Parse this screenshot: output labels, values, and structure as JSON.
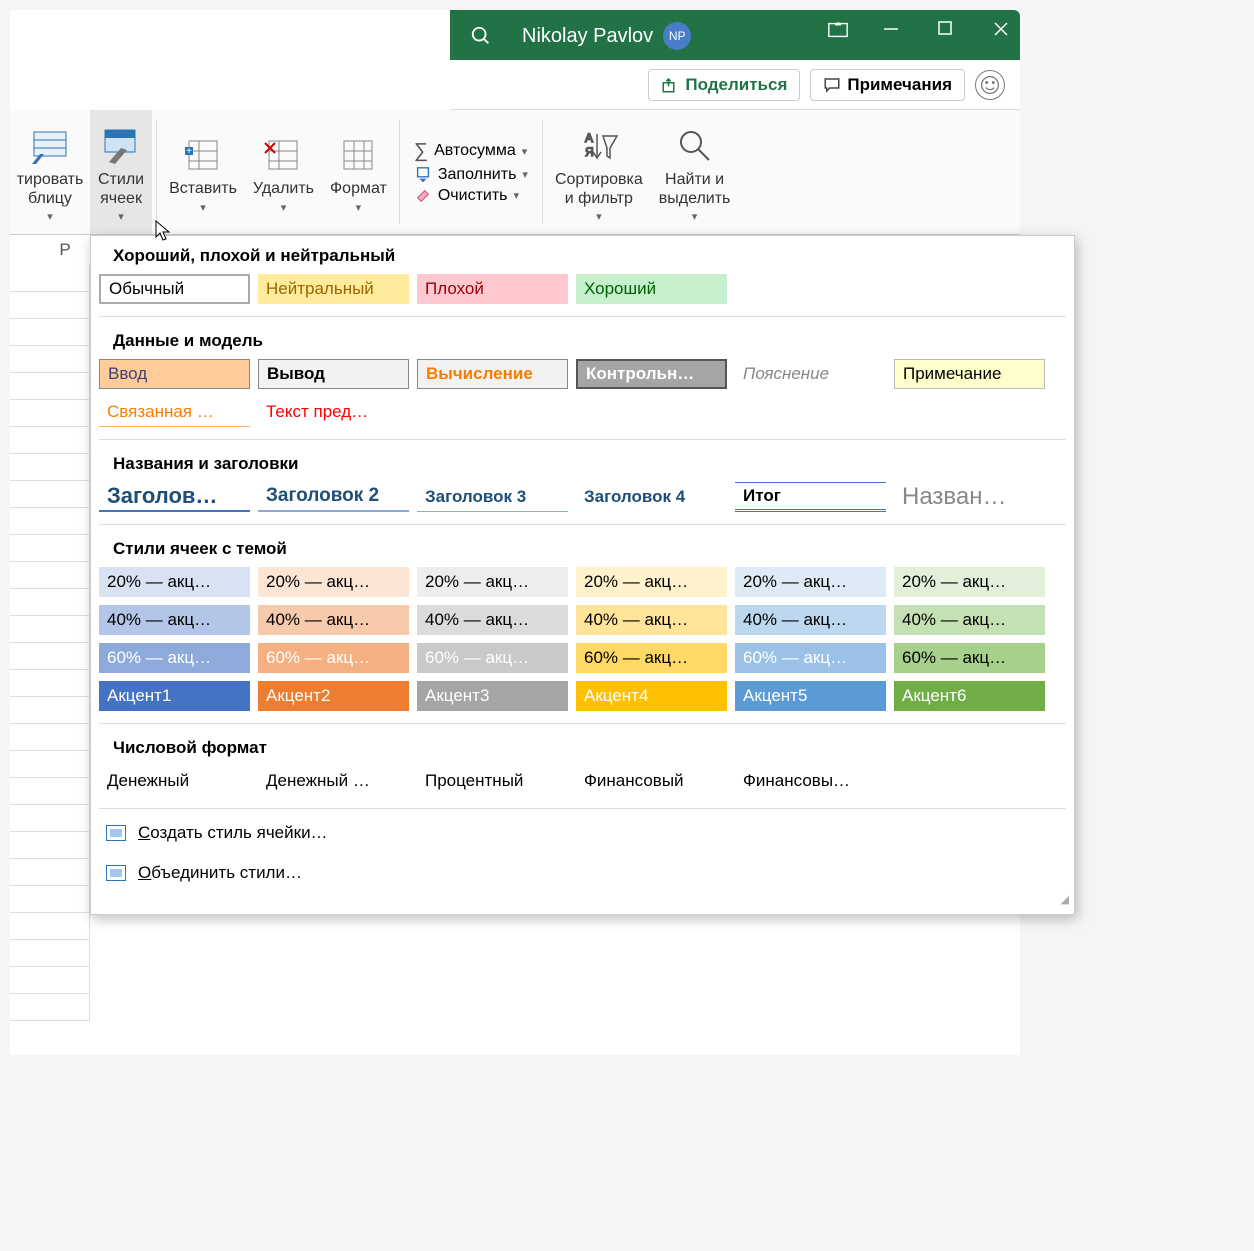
{
  "titlebar": {
    "user_name": "Nikolay Pavlov",
    "avatar_initials": "NP"
  },
  "actions": {
    "share": "Поделиться",
    "comments": "Примечания"
  },
  "ribbon": {
    "format_table": "тировать\nблицу",
    "cell_styles": "Стили\nячеек",
    "insert": "Вставить",
    "delete": "Удалить",
    "format": "Формат",
    "autosum": "Автосумма",
    "fill": "Заполнить",
    "clear": "Очистить",
    "sort_filter": "Сортировка\nи фильтр",
    "find_select": "Найти и\nвыделить"
  },
  "column_header": "P",
  "dropdown": {
    "sec1_title": "Хороший, плохой и нейтральный",
    "sec1": [
      "Обычный",
      "Нейтральный",
      "Плохой",
      "Хороший"
    ],
    "sec2_title": "Данные и модель",
    "sec2_r1": [
      "Ввод",
      "Вывод",
      "Вычисление",
      "Контрольн…",
      "Пояснение",
      "Примечание"
    ],
    "sec2_r2": [
      "Связанная …",
      "Текст пред…"
    ],
    "sec3_title": "Названия и заголовки",
    "sec3": [
      "Заголов…",
      "Заголовок 2",
      "Заголовок 3",
      "Заголовок 4",
      "Итог",
      "Назван…"
    ],
    "sec4_title": "Стили ячеек с темой",
    "accent20": "20% — акц…",
    "accent40": "40% — акц…",
    "accent60": "60% — акц…",
    "accent_labels": [
      "Акцент1",
      "Акцент2",
      "Акцент3",
      "Акцент4",
      "Акцент5",
      "Акцент6"
    ],
    "sec5_title": "Числовой формат",
    "sec5": [
      "Денежный",
      "Денежный …",
      "Процентный",
      "Финансовый",
      "Финансовы…"
    ],
    "create": "Создать стиль ячейки…",
    "merge": "Объединить стили…"
  },
  "theme_colors": {
    "c1": {
      "b20": "#d9e2f2",
      "b40": "#b4c6e7",
      "b60": "#8eaadb",
      "full": "#4472c4"
    },
    "c2": {
      "b20": "#fbe5d5",
      "b40": "#f7caac",
      "b60": "#f4b083",
      "full": "#ed7d31"
    },
    "c3": {
      "b20": "#ededed",
      "b40": "#dbdbdb",
      "b60": "#c9c9c9",
      "full": "#a5a5a5"
    },
    "c4": {
      "b20": "#fff2cc",
      "b40": "#fee599",
      "b60": "#fed966",
      "full": "#ffc000"
    },
    "c5": {
      "b20": "#deebf6",
      "b40": "#bdd7ee",
      "b60": "#9bc2e6",
      "full": "#5b9bd5"
    },
    "c6": {
      "b20": "#e2efd9",
      "b40": "#c5e0b3",
      "b60": "#a8d08d",
      "full": "#70ad47"
    }
  }
}
